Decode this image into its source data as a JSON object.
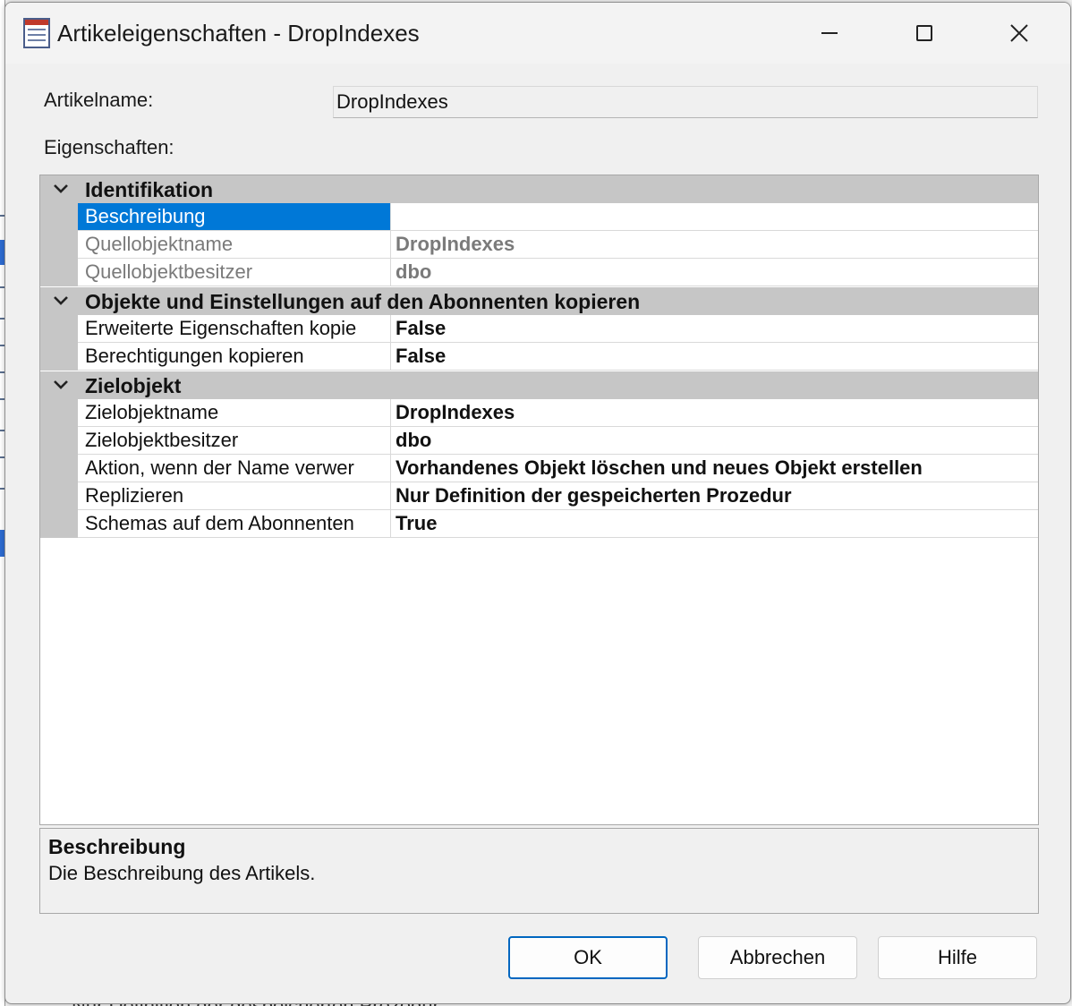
{
  "window": {
    "title": "Artikeleigenschaften - DropIndexes"
  },
  "article": {
    "name_label": "Artikelname:",
    "name_value": "DropIndexes",
    "properties_label": "Eigenschaften:"
  },
  "grid": {
    "categories": [
      {
        "label": "Identifikation",
        "rows": [
          {
            "name": "Beschreibung",
            "value": "",
            "state": "selected"
          },
          {
            "name": "Quellobjektname",
            "value": "DropIndexes",
            "state": "disabled"
          },
          {
            "name": "Quellobjektbesitzer",
            "value": "dbo",
            "state": "disabled"
          }
        ]
      },
      {
        "label": "Objekte und Einstellungen auf den Abonnenten kopieren",
        "rows": [
          {
            "name": "Erweiterte Eigenschaften kopie",
            "value": "False",
            "state": "normal"
          },
          {
            "name": "Berechtigungen kopieren",
            "value": "False",
            "state": "normal"
          }
        ]
      },
      {
        "label": "Zielobjekt",
        "rows": [
          {
            "name": "Zielobjektname",
            "value": "DropIndexes",
            "state": "normal"
          },
          {
            "name": "Zielobjektbesitzer",
            "value": "dbo",
            "state": "normal"
          },
          {
            "name": "Aktion, wenn der Name verwer",
            "value": "Vorhandenes Objekt löschen und neues Objekt erstellen",
            "state": "normal"
          },
          {
            "name": "Replizieren",
            "value": "Nur Definition der gespeicherten Prozedur",
            "state": "normal"
          },
          {
            "name": "Schemas auf dem Abonnenten",
            "value": "True",
            "state": "normal"
          }
        ]
      }
    ]
  },
  "description": {
    "title": "Beschreibung",
    "text": "Die Beschreibung des Artikels."
  },
  "buttons": {
    "ok": "OK",
    "cancel": "Abbrechen",
    "help": "Hilfe"
  },
  "background": {
    "partial_text": "Nur Definition der gespeicherten Prozedur"
  },
  "colors": {
    "selection": "#0078d7",
    "category_band": "#c6c6c6",
    "default_button_border": "#0067c0"
  }
}
